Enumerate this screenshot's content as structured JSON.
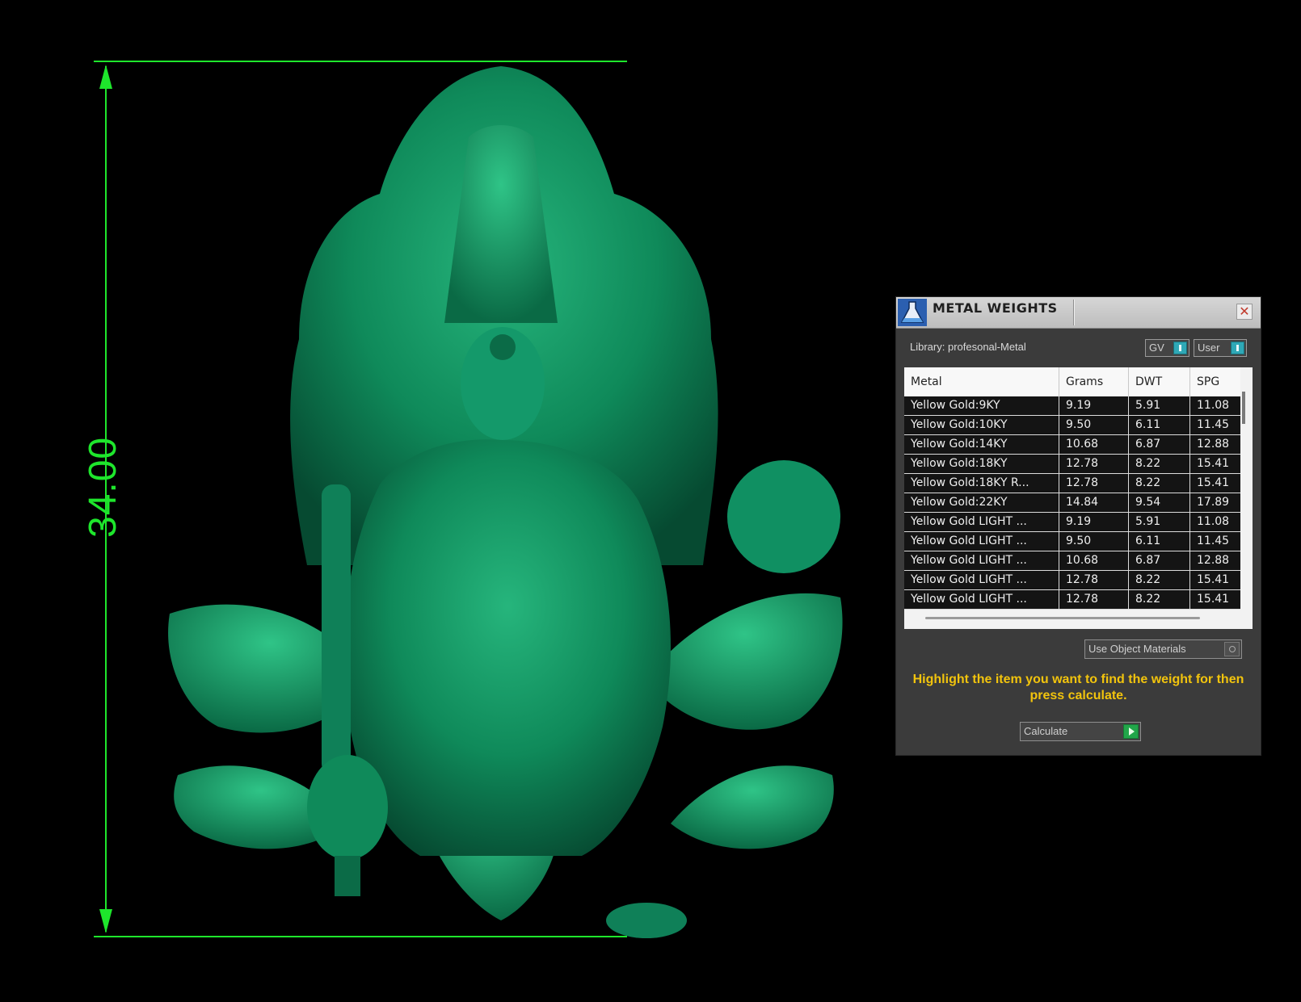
{
  "dimension": {
    "value": "34.00",
    "color": "#1ee62c"
  },
  "model": {
    "name": "deity-pendant-model",
    "color": "#0e8a5a"
  },
  "panel": {
    "title": "METAL WEIGHTS",
    "close_icon": "close-icon",
    "library_label": "Library: profesonal-Metal",
    "toggles": {
      "gv": "GV",
      "user": "User"
    },
    "table": {
      "columns": [
        "Metal",
        "Grams",
        "DWT",
        "SPG"
      ],
      "rows": [
        {
          "metal": "Yellow Gold:9KY",
          "grams": "9.19",
          "dwt": "5.91",
          "spg": "11.08"
        },
        {
          "metal": "Yellow Gold:10KY",
          "grams": "9.50",
          "dwt": "6.11",
          "spg": "11.45"
        },
        {
          "metal": "Yellow Gold:14KY",
          "grams": "10.68",
          "dwt": "6.87",
          "spg": "12.88"
        },
        {
          "metal": "Yellow Gold:18KY",
          "grams": "12.78",
          "dwt": "8.22",
          "spg": "15.41"
        },
        {
          "metal": "Yellow Gold:18KY R...",
          "grams": "12.78",
          "dwt": "8.22",
          "spg": "15.41"
        },
        {
          "metal": "Yellow Gold:22KY",
          "grams": "14.84",
          "dwt": "9.54",
          "spg": "17.89"
        },
        {
          "metal": "Yellow Gold LIGHT ...",
          "grams": "9.19",
          "dwt": "5.91",
          "spg": "11.08"
        },
        {
          "metal": "Yellow Gold LIGHT ...",
          "grams": "9.50",
          "dwt": "6.11",
          "spg": "11.45"
        },
        {
          "metal": "Yellow Gold LIGHT ...",
          "grams": "10.68",
          "dwt": "6.87",
          "spg": "12.88"
        },
        {
          "metal": "Yellow Gold LIGHT ...",
          "grams": "12.78",
          "dwt": "8.22",
          "spg": "15.41"
        },
        {
          "metal": "Yellow Gold LIGHT ...",
          "grams": "12.78",
          "dwt": "8.22",
          "spg": "15.41"
        }
      ]
    },
    "use_object_materials": "Use Object Materials",
    "hint": "Highlight the item you want to find the weight for then press calculate.",
    "calculate": "Calculate",
    "colors": {
      "hint": "#f2c40d",
      "panel_bg": "#3b3b3b",
      "toggle_knob": "#2fa8b6",
      "calc_go": "#22a64a"
    }
  }
}
